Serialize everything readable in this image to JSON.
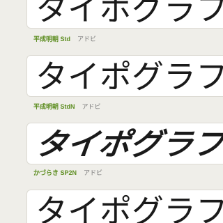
{
  "sample_text": "タイポグラフィをク",
  "fonts": [
    {
      "name": "平成明朝 Std",
      "vendor": "アドビ"
    },
    {
      "name": "平成明朝 StdN",
      "vendor": "アドビ"
    },
    {
      "name": "かづらき SP2N",
      "vendor": "アドビ"
    }
  ],
  "colors": {
    "font_name": "#5e8e22",
    "vendor": "#777777",
    "background": "#efeee9",
    "card": "#ffffff"
  }
}
